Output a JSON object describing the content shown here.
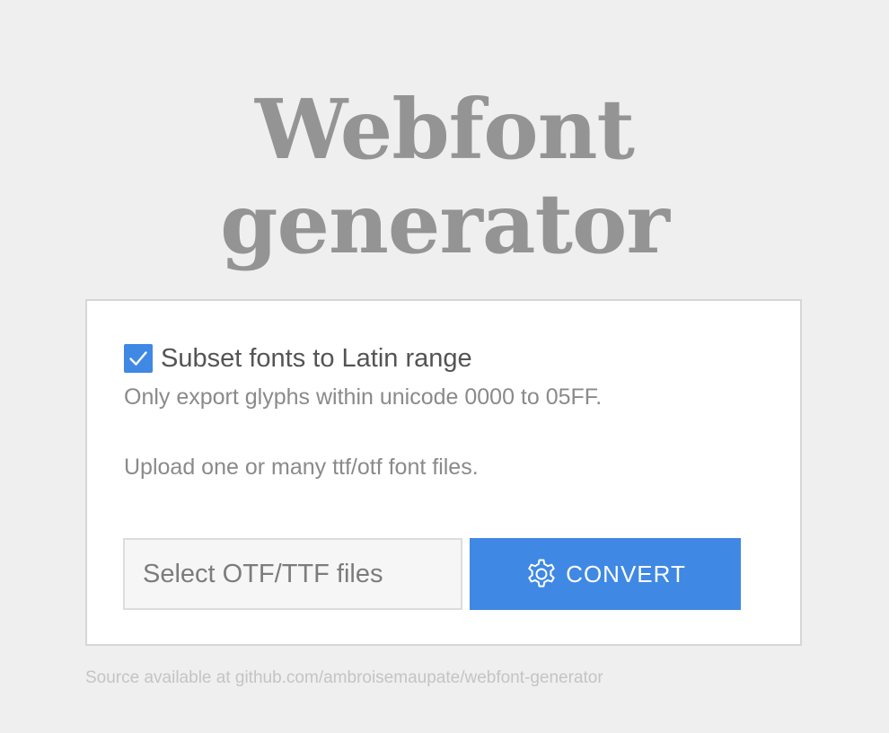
{
  "header": {
    "title_line1": "Webfont",
    "title_line2": "generator"
  },
  "options": {
    "subset_label": "Subset fonts to Latin range",
    "subset_checked": true,
    "subset_hint": "Only export glyphs within unicode 0000 to 05FF.",
    "upload_hint": "Upload one or many ttf/otf font files."
  },
  "upload": {
    "placeholder": "Select OTF/TTF files",
    "convert_label": "CONVERT",
    "convert_icon": "gear-icon"
  },
  "footer": {
    "prefix": "Source available at ",
    "link_text": "github.com/ambroisemaupate/webfont-generator"
  },
  "colors": {
    "background": "#efefef",
    "title": "#949494",
    "accent": "#3f88e4",
    "panel": "#ffffff"
  }
}
